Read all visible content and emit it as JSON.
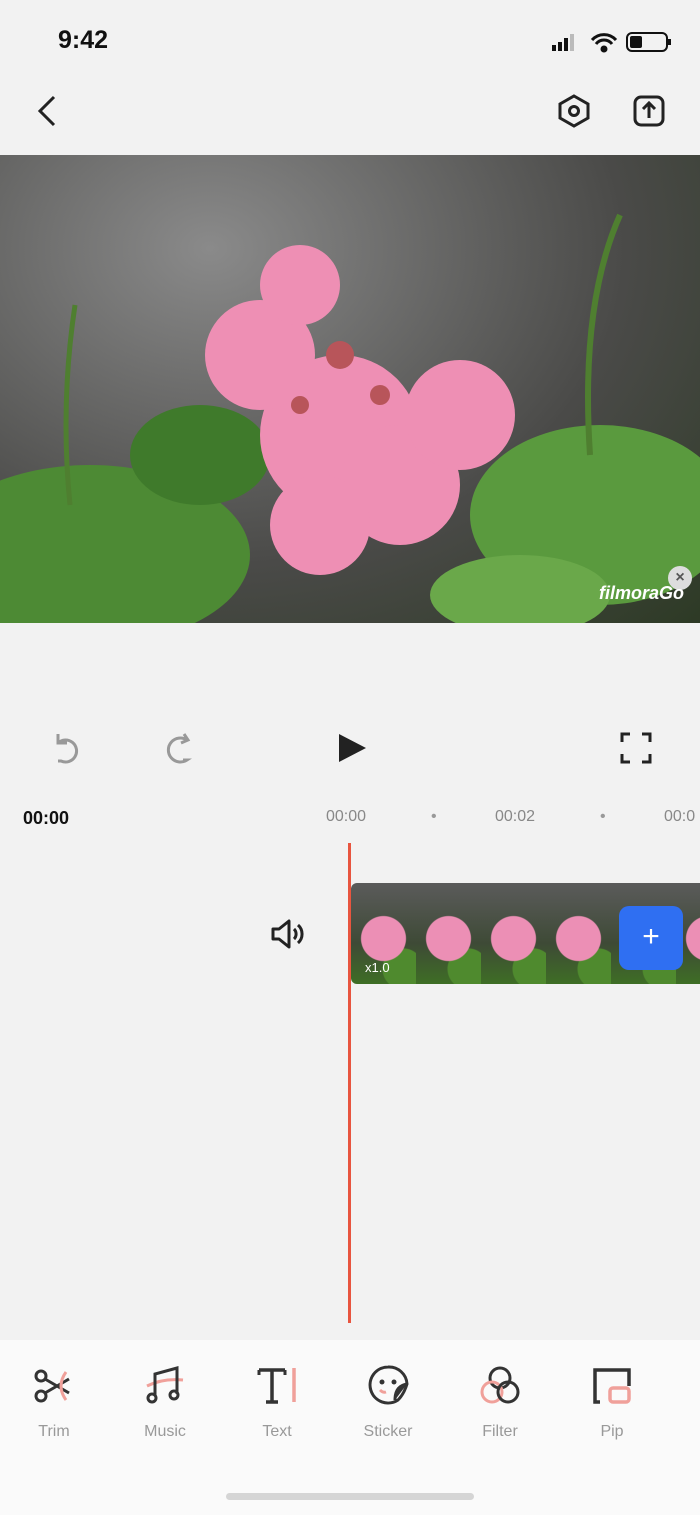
{
  "status_bar": {
    "time": "9:42"
  },
  "preview": {
    "watermark": "filmoraGo"
  },
  "timeline": {
    "current_time": "00:00",
    "ticks": [
      "00:00",
      "00:02",
      "00:0"
    ],
    "clip_speed": "x1.0",
    "add_label": "+"
  },
  "colors": {
    "accent": "#e8553f",
    "add_button": "#2f6ff2",
    "tool_accent": "#f0a09a"
  },
  "toolbar": [
    {
      "label": "Trim",
      "icon": "scissors-icon"
    },
    {
      "label": "Music",
      "icon": "music-icon"
    },
    {
      "label": "Text",
      "icon": "text-icon"
    },
    {
      "label": "Sticker",
      "icon": "sticker-icon"
    },
    {
      "label": "Filter",
      "icon": "filter-icon"
    },
    {
      "label": "Pip",
      "icon": "pip-icon"
    }
  ]
}
